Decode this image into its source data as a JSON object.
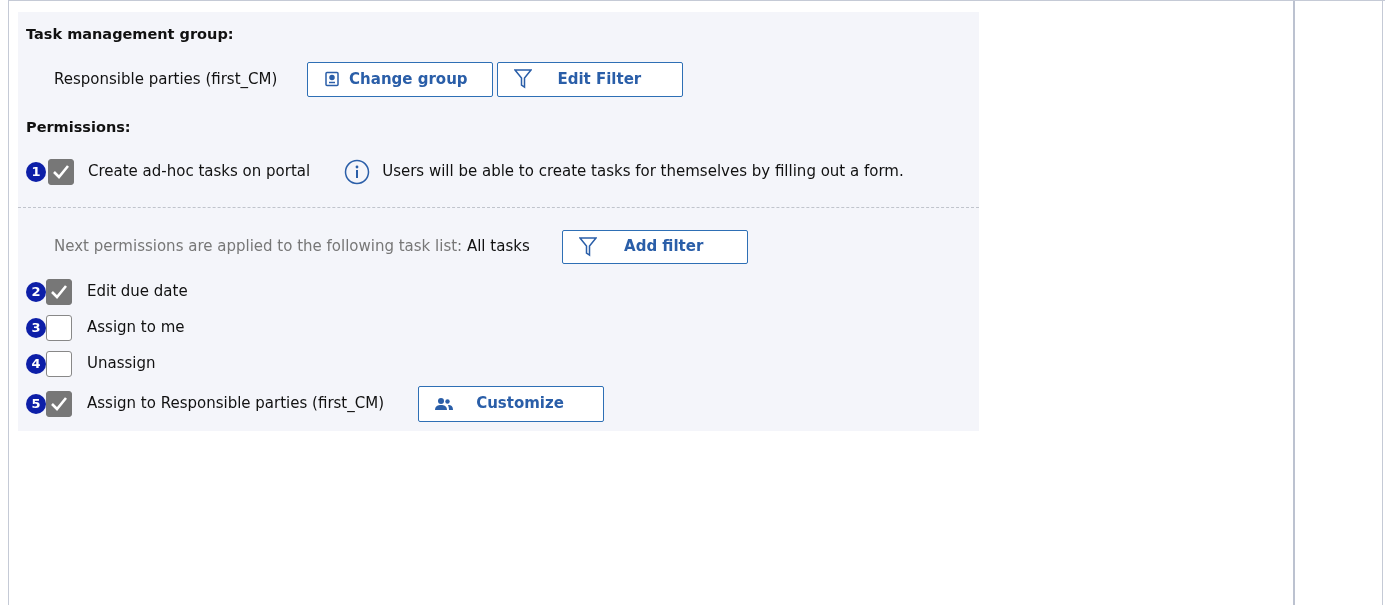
{
  "group_title": "Task management group:",
  "group": {
    "name": "Responsible parties (first_CM)",
    "buttons": [
      {
        "label": "Change group",
        "kind": "contact"
      },
      {
        "label": "Edit Filter",
        "kind": "filter"
      }
    ]
  },
  "permissions_title": "Permissions:",
  "portal_permission": {
    "marker": "1",
    "label": "Create ad-hoc tasks on portal",
    "checked": true,
    "info": "Users will be able to create tasks for themselves by filling out a form."
  },
  "task_list": {
    "text": "Next permissions are applied to the following task list:",
    "value": "All tasks",
    "button": {
      "label": "Add filter",
      "kind": "filter"
    }
  },
  "permissions": [
    {
      "marker": "2",
      "label": "Edit due date",
      "checked": true
    },
    {
      "marker": "3",
      "label": "Assign to me",
      "checked": false
    },
    {
      "marker": "4",
      "label": "Unassign",
      "checked": false
    },
    {
      "marker": "5",
      "label": "Assign to Responsible parties (first_CM)",
      "checked": true,
      "button": {
        "label": "Customize",
        "kind": "users"
      }
    }
  ]
}
